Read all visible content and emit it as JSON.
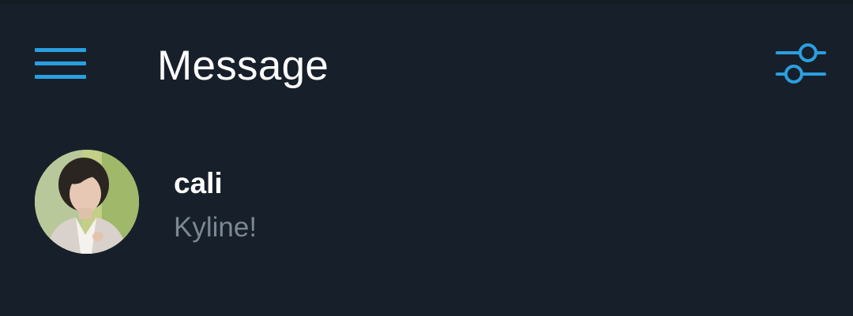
{
  "header": {
    "title": "Message",
    "menu_icon": "hamburger-menu-icon",
    "filter_icon": "sliders-filter-icon"
  },
  "conversations": [
    {
      "name": "cali",
      "last_message": "Kyline!",
      "avatar": "profile-photo"
    }
  ],
  "colors": {
    "background": "#17202a",
    "accent": "#2a9fe0",
    "title_text": "#ffffff",
    "secondary_text": "#7b8793"
  }
}
